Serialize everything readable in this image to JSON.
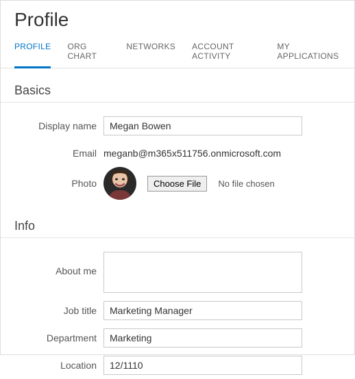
{
  "header": {
    "title": "Profile"
  },
  "tabs": {
    "profile": "PROFILE",
    "org_chart": "ORG CHART",
    "networks": "NETWORKS",
    "account_activity": "ACCOUNT ACTIVITY",
    "my_applications": "MY APPLICATIONS"
  },
  "sections": {
    "basics": {
      "title": "Basics",
      "fields": {
        "display_name": {
          "label": "Display name",
          "value": "Megan Bowen"
        },
        "email": {
          "label": "Email",
          "value": "meganb@m365x511756.onmicrosoft.com"
        },
        "photo": {
          "label": "Photo",
          "button": "Choose File",
          "status": "No file chosen"
        }
      }
    },
    "info": {
      "title": "Info",
      "fields": {
        "about_me": {
          "label": "About me",
          "value": ""
        },
        "job_title": {
          "label": "Job title",
          "value": "Marketing Manager"
        },
        "department": {
          "label": "Department",
          "value": "Marketing"
        },
        "location": {
          "label": "Location",
          "value": "12/1110"
        }
      }
    }
  }
}
